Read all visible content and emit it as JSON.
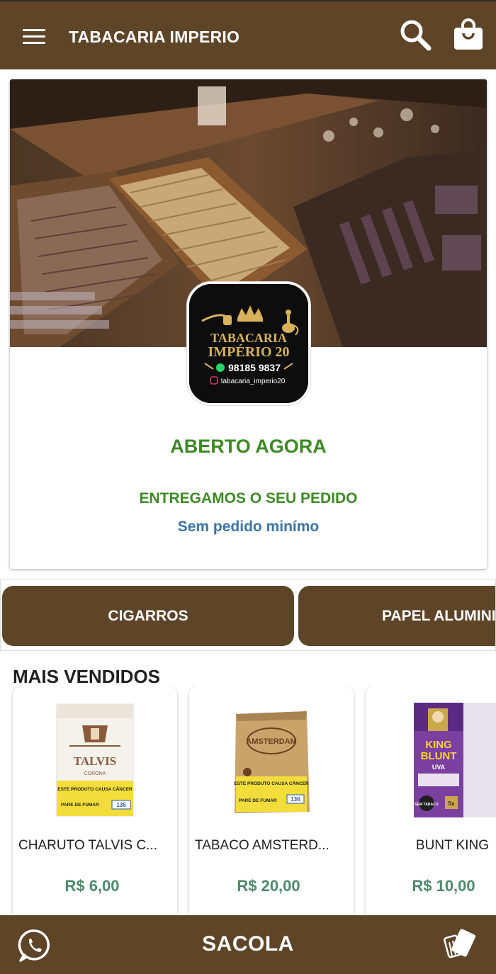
{
  "header": {
    "title": "TABACARIA IMPERIO",
    "menu_icon": "hamburger-menu-icon",
    "search_icon": "search-icon",
    "bag_icon": "shopping-bag-icon",
    "bar_color": "#5e4528"
  },
  "store": {
    "logo": {
      "line1": "TABACARIA",
      "line2": "IMPÉRIO 20",
      "phone": "98185 9837",
      "instagram": "tabacaria_imperio20"
    },
    "status": "ABERTO AGORA",
    "delivery": "ENTREGAMOS O SEU PEDIDO",
    "min_order": "Sem pedido minímo",
    "status_color": "#3d8a25",
    "min_order_color": "#3b74a6"
  },
  "categories": [
    {
      "label": "CIGARROS"
    },
    {
      "label": "PAPEL ALUMINIO"
    }
  ],
  "best_sellers": {
    "title": "MAIS VENDIDOS",
    "products": [
      {
        "name": "CHARUTO TALVIS C...",
        "price": "R$ 6,00",
        "pack": {
          "brand": "TALVIS",
          "sub": "CORONA",
          "warning": "ESTE PRODUTO CAUSA CÂNCER",
          "side": "PARE DE FUMAR",
          "number": "136"
        }
      },
      {
        "name": "TABACO AMSTERD...",
        "price": "R$ 20,00",
        "pack": {
          "brand": "AMSTERDAM",
          "warning": "ESTE PRODUTO CAUSA CÂNCER",
          "side": "PARE DE FUMAR",
          "number": "136"
        }
      },
      {
        "name": "BUNT KING",
        "price": "R$ 10,00",
        "pack": {
          "brand1": "KING",
          "brand2": "BLUNT",
          "flavor": "UVA",
          "badge": "SEM TABACO",
          "count": "5x"
        }
      }
    ],
    "price_color": "#4e8a6d"
  },
  "footer": {
    "bag_label": "SACOLA",
    "whatsapp_icon": "whatsapp-icon",
    "cards_icon": "cards-icon"
  }
}
